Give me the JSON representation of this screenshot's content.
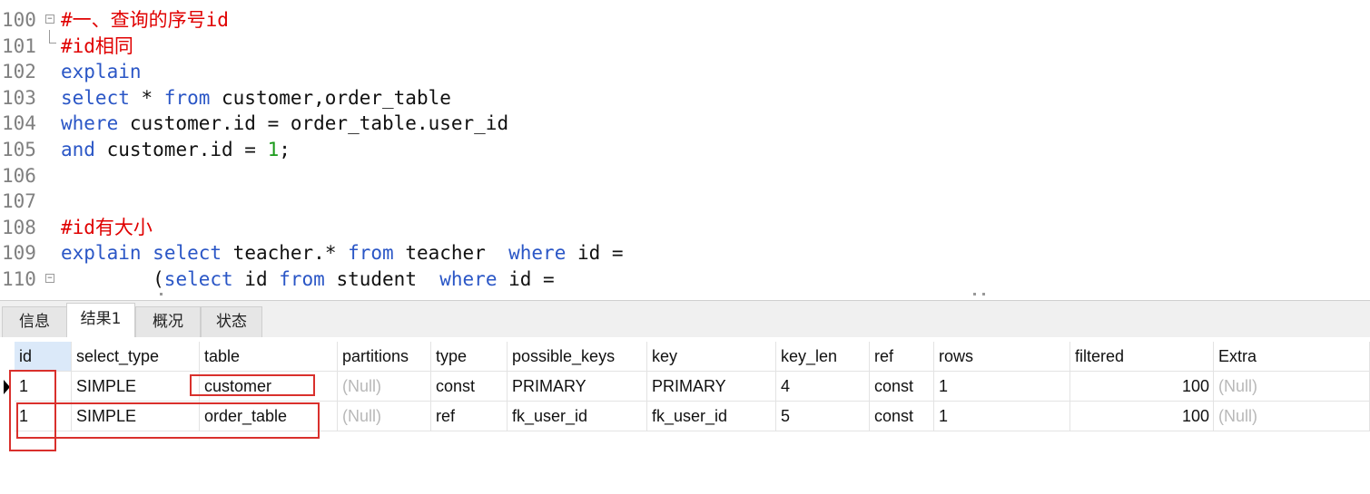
{
  "editor": {
    "lines": [
      {
        "num": "100",
        "fold": "open",
        "tokens": [
          {
            "t": "#一、查询的序号id",
            "c": "cm"
          }
        ]
      },
      {
        "num": "101",
        "fold": "end",
        "tokens": [
          {
            "t": "#id相同",
            "c": "cm"
          }
        ]
      },
      {
        "num": "102",
        "fold": "",
        "tokens": [
          {
            "t": "explain",
            "c": "kw"
          }
        ]
      },
      {
        "num": "103",
        "fold": "",
        "tokens": [
          {
            "t": "select",
            "c": "kw"
          },
          {
            "t": " * ",
            "c": "tx"
          },
          {
            "t": "from",
            "c": "kw"
          },
          {
            "t": " customer,order_table",
            "c": "tx"
          }
        ]
      },
      {
        "num": "104",
        "fold": "",
        "tokens": [
          {
            "t": "where",
            "c": "kw"
          },
          {
            "t": " customer.id = order_table.user_id",
            "c": "tx"
          }
        ]
      },
      {
        "num": "105",
        "fold": "",
        "tokens": [
          {
            "t": "and",
            "c": "kw"
          },
          {
            "t": " customer.id = ",
            "c": "tx"
          },
          {
            "t": "1",
            "c": "nm"
          },
          {
            "t": ";",
            "c": "tx"
          }
        ]
      },
      {
        "num": "106",
        "fold": "",
        "tokens": []
      },
      {
        "num": "107",
        "fold": "",
        "tokens": []
      },
      {
        "num": "108",
        "fold": "",
        "tokens": [
          {
            "t": "#id有大小",
            "c": "cm"
          }
        ]
      },
      {
        "num": "109",
        "fold": "",
        "tokens": [
          {
            "t": "explain",
            "c": "kw"
          },
          {
            "t": " ",
            "c": "tx"
          },
          {
            "t": "select",
            "c": "kw"
          },
          {
            "t": " teacher.* ",
            "c": "tx"
          },
          {
            "t": "from",
            "c": "kw"
          },
          {
            "t": " teacher  ",
            "c": "tx"
          },
          {
            "t": "where",
            "c": "kw"
          },
          {
            "t": " id =",
            "c": "tx"
          }
        ]
      },
      {
        "num": "110",
        "fold": "open",
        "tokens": [
          {
            "t": "        (",
            "c": "tx"
          },
          {
            "t": "select",
            "c": "kw"
          },
          {
            "t": " id ",
            "c": "tx"
          },
          {
            "t": "from",
            "c": "kw"
          },
          {
            "t": " student  ",
            "c": "tx"
          },
          {
            "t": "where",
            "c": "kw"
          },
          {
            "t": " id =",
            "c": "tx"
          }
        ]
      }
    ]
  },
  "tabs": [
    {
      "label": "信息",
      "active": false
    },
    {
      "label": "结果1",
      "active": true
    },
    {
      "label": "概况",
      "active": false
    },
    {
      "label": "状态",
      "active": false
    }
  ],
  "grid": {
    "columns": [
      "id",
      "select_type",
      "table",
      "partitions",
      "type",
      "possible_keys",
      "key",
      "key_len",
      "ref",
      "rows",
      "filtered",
      "Extra"
    ],
    "rows": [
      [
        "1",
        "SIMPLE",
        "customer",
        "(Null)",
        "const",
        "PRIMARY",
        "PRIMARY",
        "4",
        "const",
        "1",
        "100",
        "(Null)"
      ],
      [
        "1",
        "SIMPLE",
        "order_table",
        "(Null)",
        "ref",
        "fk_user_id",
        "fk_user_id",
        "5",
        "const",
        "1",
        "100",
        "(Null)"
      ]
    ]
  },
  "colors": {
    "keyword": "#2a56c6",
    "comment": "#e00000",
    "number": "#1a9a1a",
    "highlight": "#d9302c",
    "selected_header": "#dbe9f9"
  }
}
